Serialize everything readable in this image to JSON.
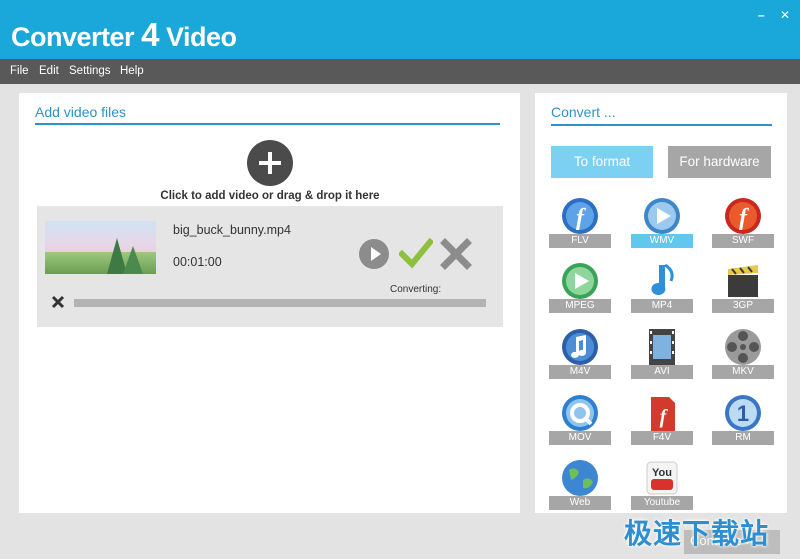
{
  "window": {
    "title_prefix": "Converter",
    "title_num": "4",
    "title_suffix": "Video",
    "minimize": "–",
    "close": "✕"
  },
  "menu": {
    "items": [
      "File",
      "Edit",
      "Settings",
      "Help"
    ]
  },
  "left_panel": {
    "title": "Add video files",
    "add_hint": "Click to add video or drag & drop it here",
    "file": {
      "name": "big_buck_bunny.mp4",
      "duration": "00:01:00",
      "status": "Converting:",
      "progress": 0
    }
  },
  "right_panel": {
    "title": "Convert ...",
    "tab_format": "To format",
    "tab_hardware": "For hardware",
    "formats": [
      {
        "label": "FLV",
        "icon": "flv-icon"
      },
      {
        "label": "WMV",
        "icon": "wmv-icon",
        "active": true
      },
      {
        "label": "SWF",
        "icon": "swf-icon"
      },
      {
        "label": "MPEG",
        "icon": "mpeg-icon"
      },
      {
        "label": "MP4",
        "icon": "mp4-icon"
      },
      {
        "label": "3GP",
        "icon": "3gp-icon"
      },
      {
        "label": "M4V",
        "icon": "m4v-icon"
      },
      {
        "label": "AVI",
        "icon": "avi-icon"
      },
      {
        "label": "MKV",
        "icon": "mkv-icon"
      },
      {
        "label": "MOV",
        "icon": "mov-icon"
      },
      {
        "label": "F4V",
        "icon": "f4v-icon"
      },
      {
        "label": "RM",
        "icon": "rm-icon"
      },
      {
        "label": "Web",
        "icon": "web-globe-icon"
      },
      {
        "label": "Youtube",
        "icon": "youtube-icon"
      }
    ]
  },
  "footer": {
    "continue_label": "Continue ›",
    "watermark": "极速下载站"
  },
  "colors": {
    "accent": "#1aa7d9",
    "menubar": "#595959",
    "panel_title": "#2b93c8"
  }
}
